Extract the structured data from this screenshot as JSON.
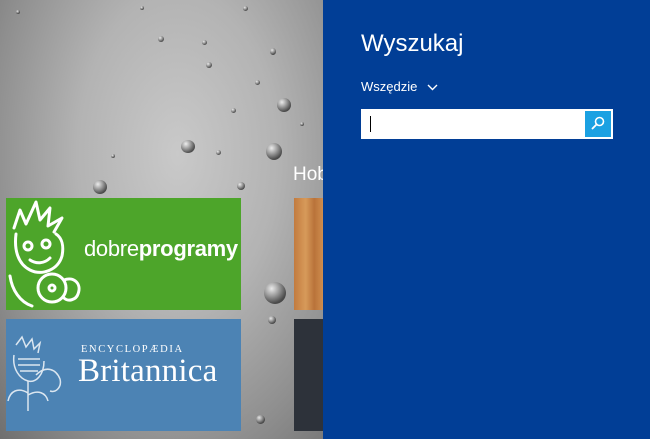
{
  "start_screen": {
    "group_title": "Hob",
    "tiles": {
      "dobreprogramy": {
        "name_light": "dobre",
        "name_bold": "programy",
        "color": "#4da52a"
      },
      "britannica": {
        "top_line": "ENCYCLOPÆDIA",
        "name": "Britannica",
        "color": "#4c83b4"
      }
    }
  },
  "search_charm": {
    "title": "Wyszukaj",
    "scope_label": "Wszędzie",
    "search_value": "",
    "background": "#013e96",
    "button_color": "#1ba1e2",
    "icons": {
      "scope": "chevron-down-icon",
      "search": "search-icon"
    }
  }
}
